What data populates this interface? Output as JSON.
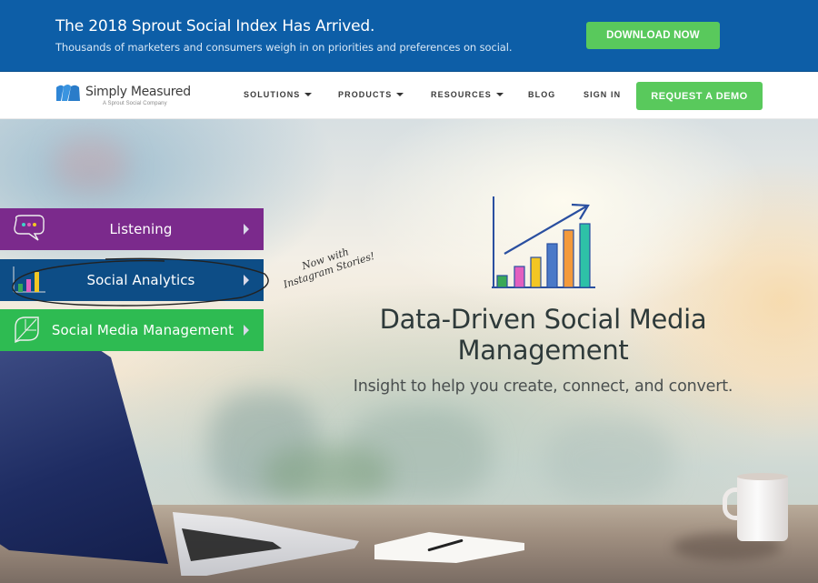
{
  "banner": {
    "title": "The 2018 Sprout Social Index Has Arrived.",
    "subtitle": "Thousands of marketers and consumers weigh in on priorities and preferences on social.",
    "cta_label": "DOWNLOAD NOW"
  },
  "nav": {
    "logo_name": "Simply Measured",
    "logo_tagline": "A Sprout Social Company",
    "items": [
      {
        "label": "SOLUTIONS",
        "icon": "caret-down-icon"
      },
      {
        "label": "PRODUCTS",
        "icon": "caret-down-icon"
      },
      {
        "label": "RESOURCES",
        "icon": "caret-down-icon"
      },
      {
        "label": "BLOG"
      },
      {
        "label": "SIGN IN"
      }
    ],
    "cta_label": "REQUEST A DEMO"
  },
  "hero": {
    "product_tabs": [
      {
        "label": "Listening",
        "icon": "speech-bubble-icon",
        "color": "#7b2a8c"
      },
      {
        "label": "Social Analytics",
        "icon": "bar-chart-icon",
        "color": "#0d4d86"
      },
      {
        "label": "Social Media Management",
        "icon": "leaf-icon",
        "color": "#2ebb52"
      }
    ],
    "annotation_line1": "Now with",
    "annotation_line2": "Instagram Stories!",
    "title": "Data-Driven Social Media Management",
    "subtitle": "Insight to help you create, connect, and convert."
  },
  "colors": {
    "banner_blue": "#0d5ea7",
    "cta_green": "#59c95c",
    "listening_purple": "#7b2a8c",
    "analytics_blue": "#0d4d86",
    "smm_green": "#2ebb52"
  }
}
